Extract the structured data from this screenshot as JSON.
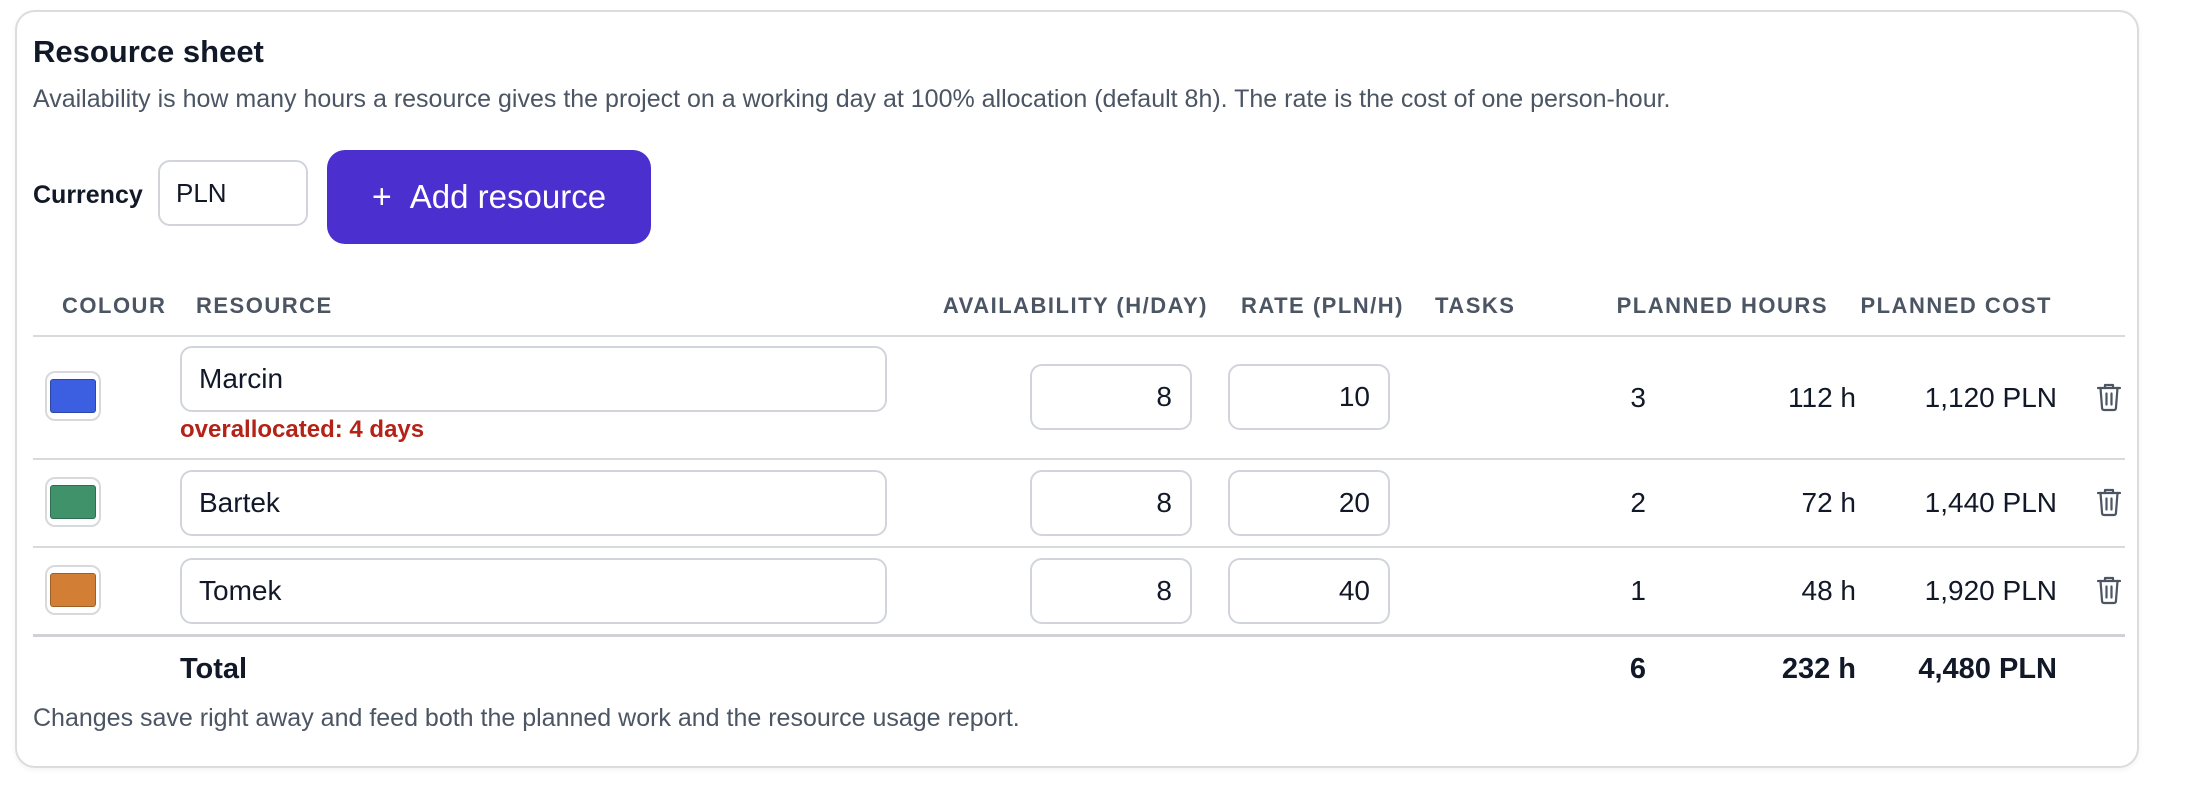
{
  "sheet": {
    "title": "Resource sheet",
    "description": "Availability is how many hours a resource gives the project on a working day at 100% allocation (default 8h). The rate is the cost of one person-hour.",
    "currency_label": "Currency",
    "currency_value": "PLN",
    "add_resource_label": "Add resource",
    "footnote": "Changes save right away and feed both the planned work and the resource usage report."
  },
  "table": {
    "headers": {
      "colour": "COLOUR",
      "resource": "RESOURCE",
      "availability": "AVAILABILITY (H/DAY)",
      "rate": "RATE (PLN/H)",
      "tasks": "TASKS",
      "planned_hours": "PLANNED HOURS",
      "planned_cost": "PLANNED COST"
    },
    "rows": [
      {
        "colour": "#3b5fe0",
        "name": "Marcin",
        "availability": "8",
        "rate": "10",
        "tasks": "3",
        "planned_hours": "112 h",
        "planned_cost": "1,120 PLN",
        "warning": "overallocated: 4 days"
      },
      {
        "colour": "#3f926a",
        "name": "Bartek",
        "availability": "8",
        "rate": "20",
        "tasks": "2",
        "planned_hours": "72 h",
        "planned_cost": "1,440 PLN"
      },
      {
        "colour": "#d27f35",
        "name": "Tomek",
        "availability": "8",
        "rate": "40",
        "tasks": "1",
        "planned_hours": "48 h",
        "planned_cost": "1,920 PLN"
      }
    ],
    "total": {
      "label": "Total",
      "tasks": "6",
      "planned_hours": "232 h",
      "planned_cost": "4,480 PLN"
    }
  },
  "icons": {
    "add": "plus-icon",
    "delete": "trash-icon"
  },
  "colors": {
    "accent": "#4b2fcf",
    "warning": "#b42318"
  }
}
